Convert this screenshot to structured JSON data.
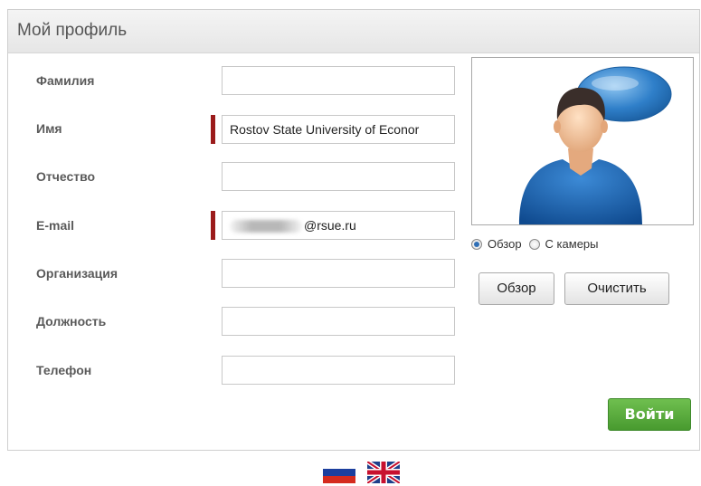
{
  "panel": {
    "title": "Мой профиль"
  },
  "form": {
    "fields": [
      {
        "label": "Фамилия",
        "value": "",
        "required": false
      },
      {
        "label": "Имя",
        "value": "Rostov State University of Econor",
        "required": true
      },
      {
        "label": "Отчество",
        "value": "",
        "required": false
      },
      {
        "label": "E-mail",
        "value": "@rsue.ru",
        "required": true
      },
      {
        "label": "Организация",
        "value": "",
        "required": false
      },
      {
        "label": "Должность",
        "value": "",
        "required": false
      },
      {
        "label": "Телефон",
        "value": "",
        "required": false
      }
    ]
  },
  "photo": {
    "source_options": [
      {
        "label": "Обзор",
        "selected": true
      },
      {
        "label": "С камеры",
        "selected": false
      }
    ],
    "browse_label": "Обзор",
    "clear_label": "Очистить"
  },
  "actions": {
    "login_label": "Войти"
  },
  "languages": [
    {
      "icon": "russian-flag-icon",
      "code": "ru"
    },
    {
      "icon": "uk-flag-icon",
      "code": "en"
    }
  ],
  "colors": {
    "required_marker": "#9b1b1b",
    "login_button": "#5aad3b",
    "radio_selected": "#2f6fb6"
  }
}
